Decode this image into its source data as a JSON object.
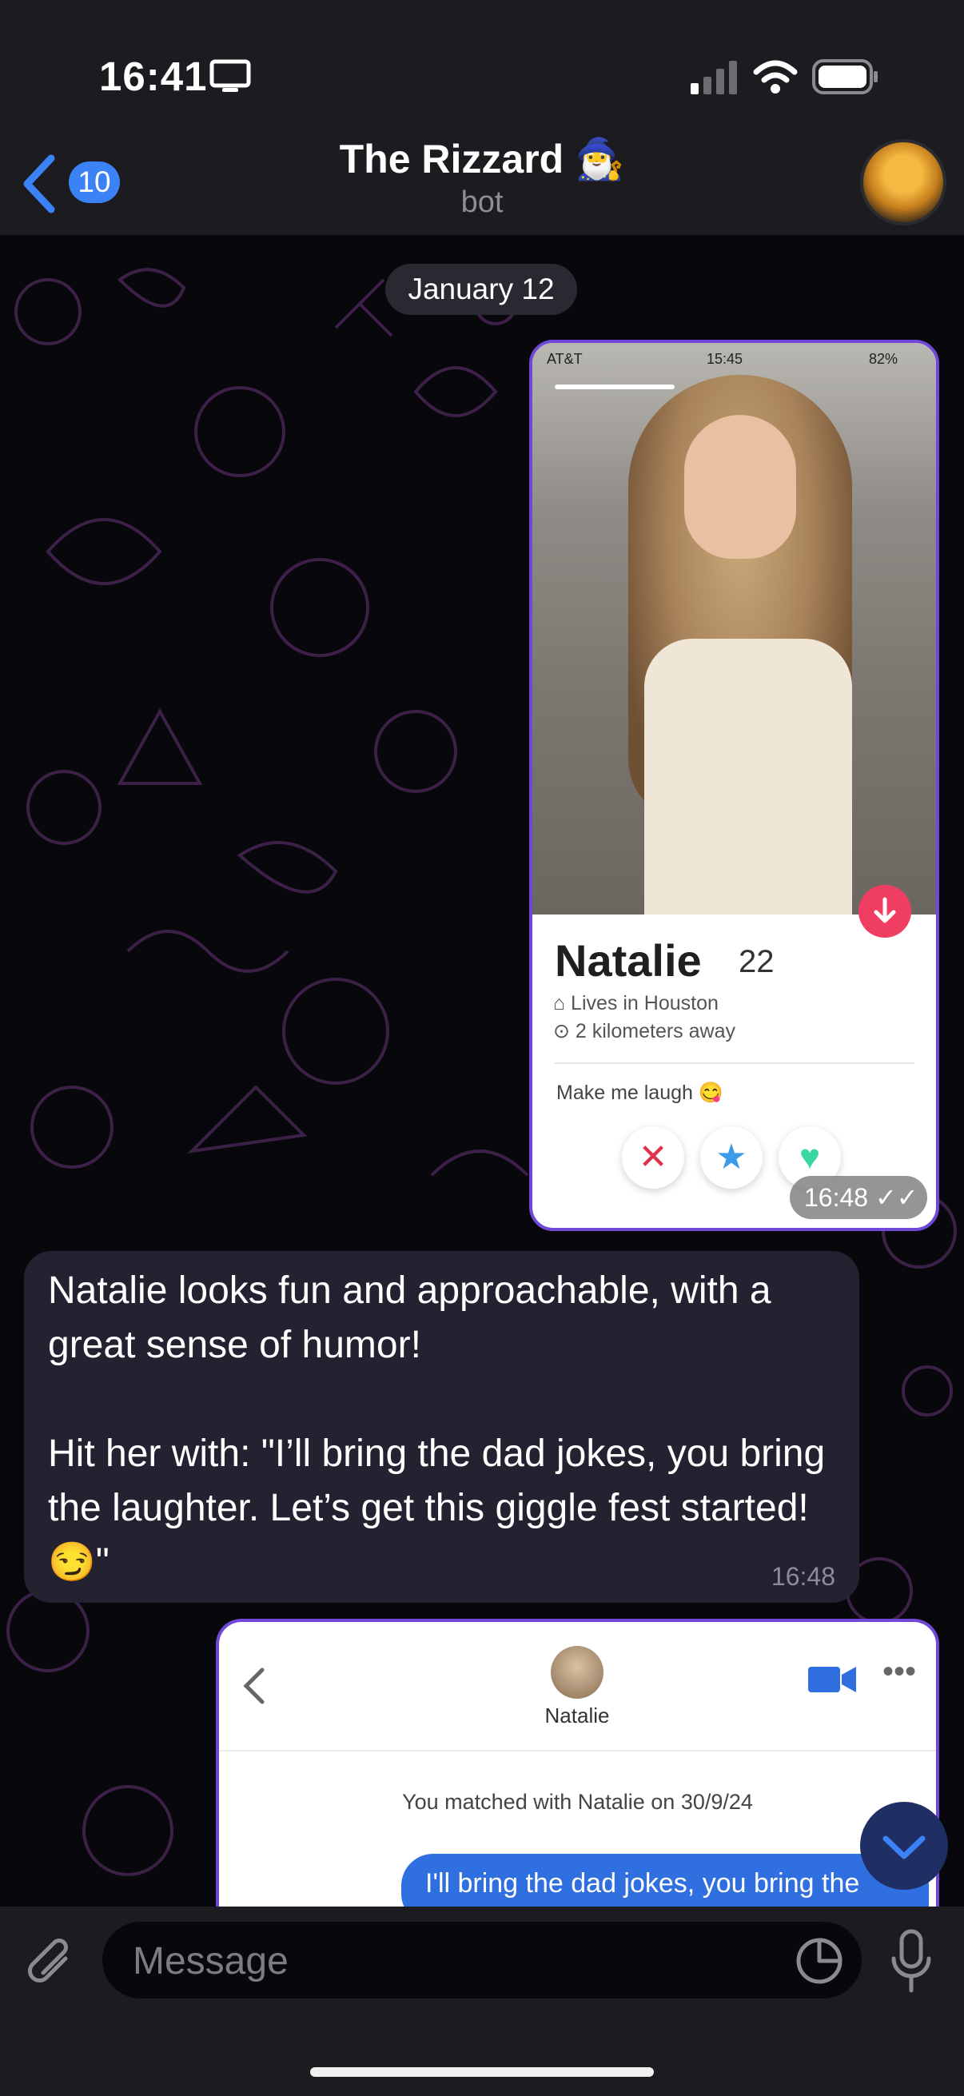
{
  "status_bar": {
    "time": "16:41"
  },
  "header": {
    "back_count": "10",
    "title": "The Rizzard 🧙‍♂️",
    "subtitle": "bot"
  },
  "date_divider": "January 12",
  "profile_card": {
    "phone_carrier": "AT&T",
    "phone_time": "15:45",
    "phone_battery": "82%",
    "name": "Natalie",
    "age": "22",
    "location": "Lives in Houston",
    "distance": "2 kilometers away",
    "bio": "Make me laugh 😋",
    "timestamp": "16:48"
  },
  "reply": {
    "text": "Natalie looks fun and approachable, with a great sense of humor!\n\nHit her with: \"I’ll bring the dad jokes, you bring the laughter. Let’s get this giggle fest started! 😏\"",
    "timestamp": "16:48"
  },
  "chat_screenshot": {
    "contact_name": "Natalie",
    "matched_text": "You matched with Natalie on 30/9/24",
    "sent_message": "I'll bring the dad jokes, you bring the"
  },
  "composer": {
    "placeholder": "Message"
  },
  "colors": {
    "accent": "#3b82f6",
    "bubble_border": "#6f48d8",
    "incoming_bubble": "#242230"
  }
}
